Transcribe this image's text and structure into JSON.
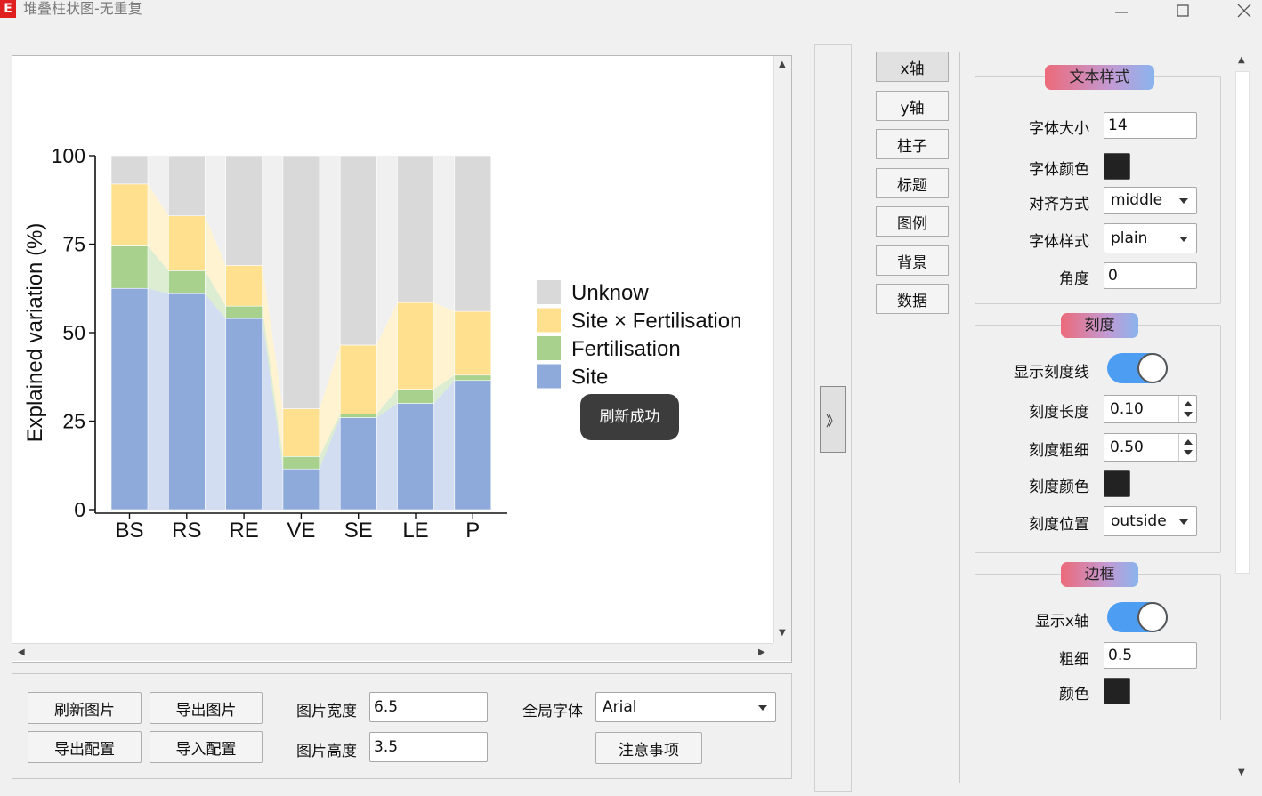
{
  "window": {
    "title": "堆叠柱状图-无重复",
    "icon_letter": "E",
    "minimize_icon": "minimize-icon",
    "maximize_icon": "maximize-icon",
    "close_icon": "close-icon"
  },
  "chart_data": {
    "type": "bar",
    "stacked": true,
    "categories": [
      "BS",
      "RS",
      "RE",
      "VE",
      "SE",
      "LE",
      "P"
    ],
    "series": [
      {
        "name": "Site",
        "color": "#8eaadb",
        "values": [
          62.5,
          61,
          54,
          11.5,
          26,
          30,
          36.5
        ]
      },
      {
        "name": "Fertilisation",
        "color": "#a9d18e",
        "values": [
          12,
          6.5,
          3.5,
          3.5,
          1,
          4,
          1.5
        ]
      },
      {
        "name": "Site × Fertilisation",
        "color": "#ffe08f",
        "values": [
          17.5,
          15.5,
          11.5,
          13.5,
          19.5,
          24.5,
          18
        ]
      },
      {
        "name": "Unknow",
        "color": "#d9d9d9",
        "values": [
          8,
          17,
          31,
          71.5,
          53.5,
          41.5,
          44
        ]
      }
    ],
    "ylabel": "Explained variation (%)",
    "xlabel": "",
    "ylim": [
      0,
      100
    ],
    "yticks": [
      "0",
      "25",
      "50",
      "75",
      "100"
    ],
    "legend_position": "right",
    "grid": false
  },
  "toast": "刷新成功",
  "bottom": {
    "refresh_image": "刷新图片",
    "export_image": "导出图片",
    "export_config": "导出配置",
    "import_config": "导入配置",
    "width_label": "图片宽度",
    "width_value": "6.5",
    "height_label": "图片高度",
    "height_value": "3.5",
    "font_label": "全局字体",
    "font_value": "Arial",
    "notes_button": "注意事项"
  },
  "collapse_glyph": "》",
  "tabs": [
    "x轴",
    "y轴",
    "柱子",
    "标题",
    "图例",
    "背景",
    "数据"
  ],
  "settings": {
    "text_style": {
      "title": "文本样式",
      "font_size_label": "字体大小",
      "font_size": "14",
      "font_color_label": "字体颜色",
      "font_color": "#222222",
      "align_label": "对齐方式",
      "align": "middle",
      "font_style_label": "字体样式",
      "font_style": "plain",
      "angle_label": "角度",
      "angle": "0"
    },
    "ticks": {
      "title": "刻度",
      "show_label": "显示刻度线",
      "show": true,
      "length_label": "刻度长度",
      "length": "0.10",
      "width_label": "刻度粗细",
      "width": "0.50",
      "color_label": "刻度颜色",
      "color": "#222222",
      "position_label": "刻度位置",
      "position": "outside"
    },
    "border": {
      "title": "边框",
      "show_label": "显示x轴",
      "show": true,
      "thickness_label": "粗细",
      "thickness": "0.5",
      "color_label": "颜色",
      "color": "#222222"
    }
  }
}
